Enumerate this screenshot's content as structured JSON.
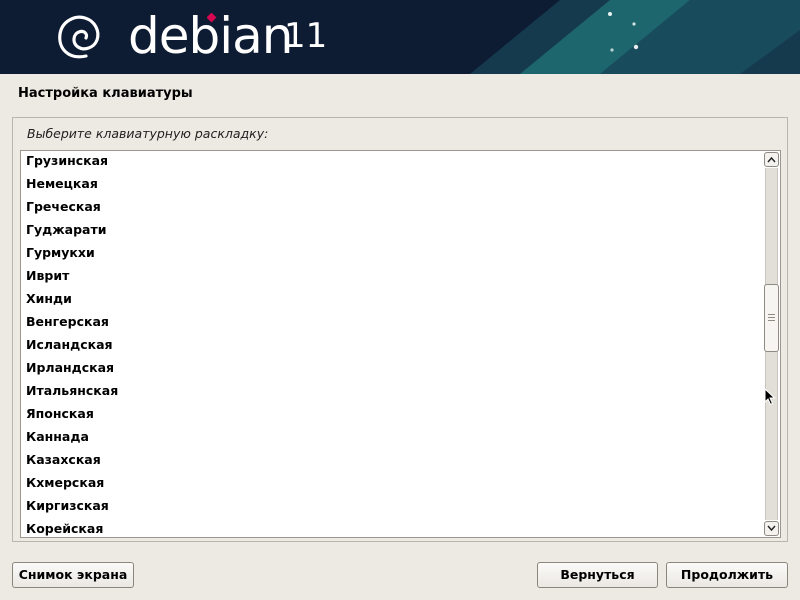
{
  "header": {
    "brand": "debian",
    "version": "11",
    "logo_icon": "debian-swirl-icon",
    "colors": {
      "background": "#0d1b33",
      "accent": "#d70751",
      "teal": "#1f6f73"
    }
  },
  "page": {
    "title": "Настройка клавиатуры",
    "prompt": "Выберите клавиатурную раскладку:"
  },
  "layouts": [
    "Грузинская",
    "Немецкая",
    "Греческая",
    "Гуджарати",
    "Гурмукхи",
    "Иврит",
    "Хинди",
    "Венгерская",
    "Исландская",
    "Ирландская",
    "Итальянская",
    "Японская",
    "Каннада",
    "Казахская",
    "Кхмерская",
    "Киргизская",
    "Корейская"
  ],
  "scrollbar": {
    "position_fraction": 0.41,
    "visible_fraction": 0.19
  },
  "buttons": {
    "screenshot": "Снимок экрана",
    "back": "Вернуться",
    "continue": "Продолжить"
  }
}
